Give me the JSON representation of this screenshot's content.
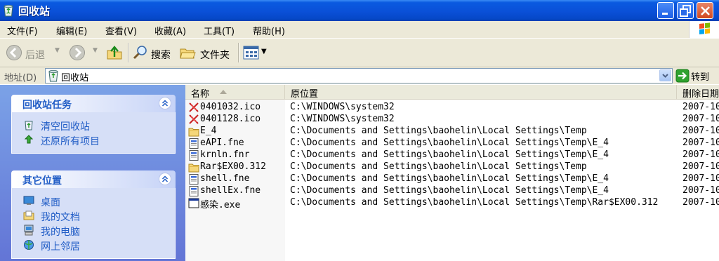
{
  "window": {
    "title": "回收站"
  },
  "menu": [
    "文件(F)",
    "编辑(E)",
    "查看(V)",
    "收藏(A)",
    "工具(T)",
    "帮助(H)"
  ],
  "toolbar": {
    "back": "后退",
    "search": "搜索",
    "folders": "文件夹"
  },
  "address": {
    "label": "地址(D)",
    "value": "回收站",
    "go": "转到"
  },
  "tasks_panel": {
    "title": "回收站任务",
    "items": [
      "清空回收站",
      "还原所有项目"
    ]
  },
  "places_panel": {
    "title": "其它位置",
    "items": [
      "桌面",
      "我的文档",
      "我的电脑",
      "网上邻居"
    ]
  },
  "columns": {
    "name": "名称",
    "location": "原位置",
    "deleted": "删除日期"
  },
  "files": [
    {
      "name": "0401032.ico",
      "location": "C:\\WINDOWS\\system32",
      "deleted": "2007-10",
      "icon": "ico-file-icon"
    },
    {
      "name": "0401128.ico",
      "location": "C:\\WINDOWS\\system32",
      "deleted": "2007-10",
      "icon": "ico-file-icon"
    },
    {
      "name": "E_4",
      "location": "C:\\Documents and Settings\\baohelin\\Local Settings\\Temp",
      "deleted": "2007-10",
      "icon": "folder-icon"
    },
    {
      "name": "eAPI.fne",
      "location": "C:\\Documents and Settings\\baohelin\\Local Settings\\Temp\\E_4",
      "deleted": "2007-10",
      "icon": "fne-file-icon"
    },
    {
      "name": "krnln.fnr",
      "location": "C:\\Documents and Settings\\baohelin\\Local Settings\\Temp\\E_4",
      "deleted": "2007-10",
      "icon": "fne-file-icon"
    },
    {
      "name": "Rar$EX00.312",
      "location": "C:\\Documents and Settings\\baohelin\\Local Settings\\Temp",
      "deleted": "2007-10",
      "icon": "folder-icon"
    },
    {
      "name": "shell.fne",
      "location": "C:\\Documents and Settings\\baohelin\\Local Settings\\Temp\\E_4",
      "deleted": "2007-10",
      "icon": "fne-file-icon"
    },
    {
      "name": "shellEx.fne",
      "location": "C:\\Documents and Settings\\baohelin\\Local Settings\\Temp\\E_4",
      "deleted": "2007-10",
      "icon": "fne-file-icon"
    },
    {
      "name": "感染.exe",
      "location": "C:\\Documents and Settings\\baohelin\\Local Settings\\Temp\\Rar$EX00.312",
      "deleted": "2007-10",
      "icon": "exe-file-icon"
    }
  ]
}
